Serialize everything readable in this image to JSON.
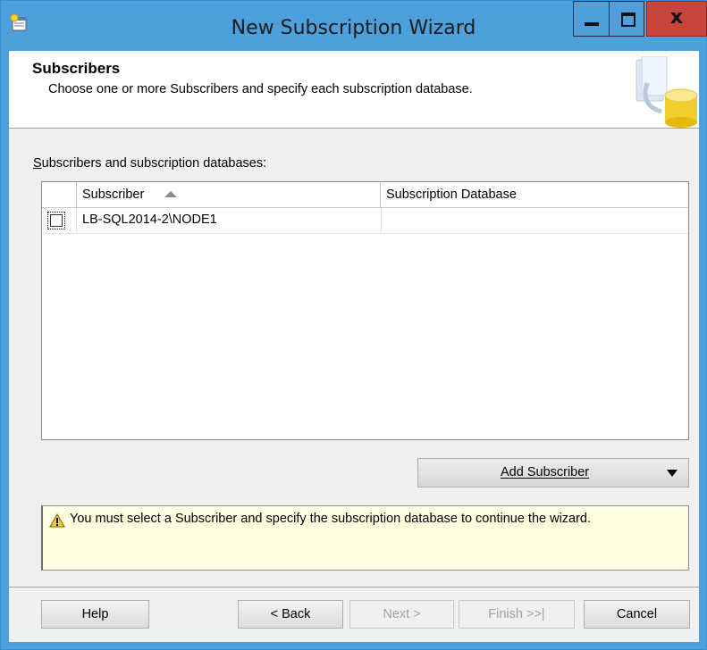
{
  "window": {
    "title": "New Subscription Wizard",
    "icon": "wizard-app-icon",
    "controls": {
      "minimize": "minimize-icon",
      "maximize": "maximize-icon",
      "close": "x"
    }
  },
  "header": {
    "title": "Subscribers",
    "subtitle": "Choose one or more Subscribers and specify each subscription database.",
    "art": "database-subscription-art"
  },
  "grid": {
    "label": "Subscribers and subscription databases:",
    "columns": [
      "Subscriber",
      "Subscription Database"
    ],
    "sort": "ascending",
    "rows": [
      {
        "checked": false,
        "subscriber": "LB-SQL2014-2\\NODE1",
        "database": ""
      }
    ]
  },
  "add_subscriber": {
    "label": "Add Subscriber",
    "icon": "dropdown-arrow-icon"
  },
  "message": {
    "icon": "warning-icon",
    "text": "You must select a Subscriber and specify the subscription database to continue the wizard."
  },
  "buttons": {
    "help": "Help",
    "back": "< Back",
    "next": "Next >",
    "finish": "Finish >>|",
    "cancel": "Cancel"
  },
  "colors": {
    "titlebar": "#4ea0dc",
    "close": "#c7453d",
    "message_bg": "#ffffe1"
  }
}
